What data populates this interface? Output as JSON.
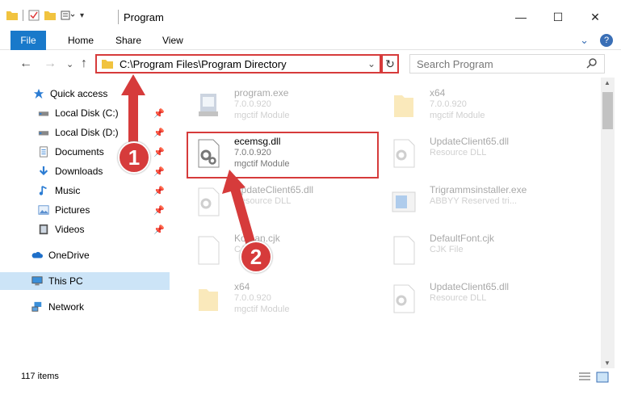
{
  "window": {
    "title": "Program",
    "minimize": "—",
    "maximize": "☐",
    "close": "✕"
  },
  "ribbon": {
    "tabs": [
      "File",
      "Home",
      "Share",
      "View"
    ],
    "collapse": "⌄",
    "help": "?"
  },
  "nav": {
    "back": "←",
    "forward": "→",
    "recent": "⌄",
    "up": "↑"
  },
  "address": {
    "path": "C:\\Program Files\\Program Directory",
    "dropdown": "⌄",
    "refresh": "↻"
  },
  "search": {
    "placeholder": "Search Program",
    "icon": "search-icon"
  },
  "sidebar": {
    "items": [
      {
        "label": "Quick access",
        "icon": "star-icon",
        "pinned": false
      },
      {
        "label": "Local Disk (C:)",
        "icon": "drive-icon",
        "pinned": true
      },
      {
        "label": "Local Disk (D:)",
        "icon": "drive-icon",
        "pinned": true
      },
      {
        "label": "Documents",
        "icon": "documents-icon",
        "pinned": true
      },
      {
        "label": "Downloads",
        "icon": "download-icon",
        "pinned": true
      },
      {
        "label": "Music",
        "icon": "music-icon",
        "pinned": true
      },
      {
        "label": "Pictures",
        "icon": "pictures-icon",
        "pinned": true
      },
      {
        "label": "Videos",
        "icon": "videos-icon",
        "pinned": true
      },
      {
        "label": "OneDrive",
        "icon": "cloud-icon",
        "pinned": false
      },
      {
        "label": "This PC",
        "icon": "computer-icon",
        "pinned": false
      },
      {
        "label": "Network",
        "icon": "network-icon",
        "pinned": false
      }
    ]
  },
  "files": [
    {
      "name": "program.exe",
      "line2": "7.0.0.920",
      "line3": "mgctif Module",
      "icon": "exe-icon"
    },
    {
      "name": "x64",
      "line2": "7.0.0.920",
      "line3": "mgctif Module",
      "icon": "folder-icon"
    },
    {
      "name": "ecemsg.dll",
      "line2": "7.0.0.920",
      "line3": "mgctif Module",
      "icon": "dll-gear-icon"
    },
    {
      "name": "UpdateClient65.dll",
      "line2": "Resource DLL",
      "line3": "",
      "icon": "dll-gear-icon"
    },
    {
      "name": "UpdateClient65.dll",
      "line2": "Resource DLL",
      "line3": "",
      "icon": "dll-gear-icon"
    },
    {
      "name": "Trigrammsinstaller.exe",
      "line2": "ABBYY Reserved tri...",
      "line3": "",
      "icon": "installer-icon"
    },
    {
      "name": "Korean.cjk",
      "line2": "CJK File",
      "line3": "",
      "icon": "file-icon"
    },
    {
      "name": "DefaultFont.cjk",
      "line2": "CJK File",
      "line3": "",
      "icon": "file-icon"
    },
    {
      "name": "x64",
      "line2": "7.0.0.920",
      "line3": "mgctif Module",
      "icon": "folder-icon"
    },
    {
      "name": "UpdateClient65.dll",
      "line2": "Resource DLL",
      "line3": "",
      "icon": "dll-gear-icon"
    }
  ],
  "annotations": {
    "step1": "1",
    "step2": "2"
  },
  "status": {
    "items": "117 items"
  }
}
